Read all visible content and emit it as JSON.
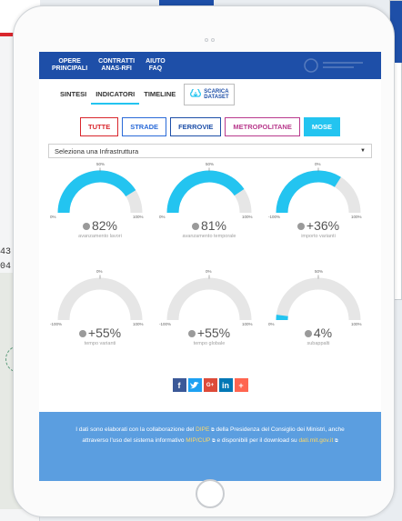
{
  "background": {
    "left_numbers": [
      "43",
      "04"
    ]
  },
  "nav": {
    "items": [
      {
        "line1": "OPERE",
        "line2": "PRINCIPALI"
      },
      {
        "line1": "CONTRATTI",
        "line2": "ANAS-RFI"
      },
      {
        "line1": "AIUTO",
        "line2": "FAQ"
      }
    ]
  },
  "tabs": {
    "sintesi": "SINTESI",
    "indicatori": "INDICATORI",
    "timeline": "TIMELINE",
    "download_line1": "SCARICA",
    "download_line2": "DATASET"
  },
  "filters": {
    "tutte": "TUTTE",
    "strade": "STRADE",
    "ferrovie": "FERROVIE",
    "metropolitane": "METROPOLITANE",
    "mose": "MOSE"
  },
  "select": {
    "value": "Seleziona una Infrastruttura"
  },
  "gauges": [
    {
      "value": "82%",
      "label": "avanzamento lavori",
      "fraction": 0.82,
      "min": "0%",
      "mid": "50%",
      "max": "100%"
    },
    {
      "value": "81%",
      "label": "avanzamento temporale",
      "fraction": 0.81,
      "min": "0%",
      "mid": "50%",
      "max": "100%"
    },
    {
      "value": "+36%",
      "label": "importo varianti",
      "fraction": 0.68,
      "min": "-100%",
      "mid": "0%",
      "max": "100%"
    },
    {
      "value": "+55%",
      "label": "tempo varianti",
      "fraction": 0.0,
      "min": "-100%",
      "mid": "0%",
      "max": "100%"
    },
    {
      "value": "+55%",
      "label": "tempo globale",
      "fraction": 0.0,
      "min": "-100%",
      "mid": "0%",
      "max": "100%"
    },
    {
      "value": "4%",
      "label": "subappalti",
      "fraction": 0.04,
      "min": "0%",
      "mid": "50%",
      "max": "100%"
    }
  ],
  "social": {
    "facebook": "f",
    "twitter": "t",
    "googleplus": "G+",
    "linkedin": "in",
    "more": "+"
  },
  "footer": {
    "t1": "I dati sono elaborati con la collaborazione del ",
    "dipe": "DIPE",
    "t2": " della Presidenza del Consiglio dei Ministri, anche attraverso l'uso del sistema informativo ",
    "mipcup": "MIP/CUP",
    "t3": " e disponibili per il download su ",
    "datimit": "dati.mit.gov.it"
  },
  "colors": {
    "primary": "#1e4fa8",
    "accent": "#23c4f0",
    "gauge_track": "#e6e6e6",
    "footer_bg": "#5b9ee0"
  }
}
